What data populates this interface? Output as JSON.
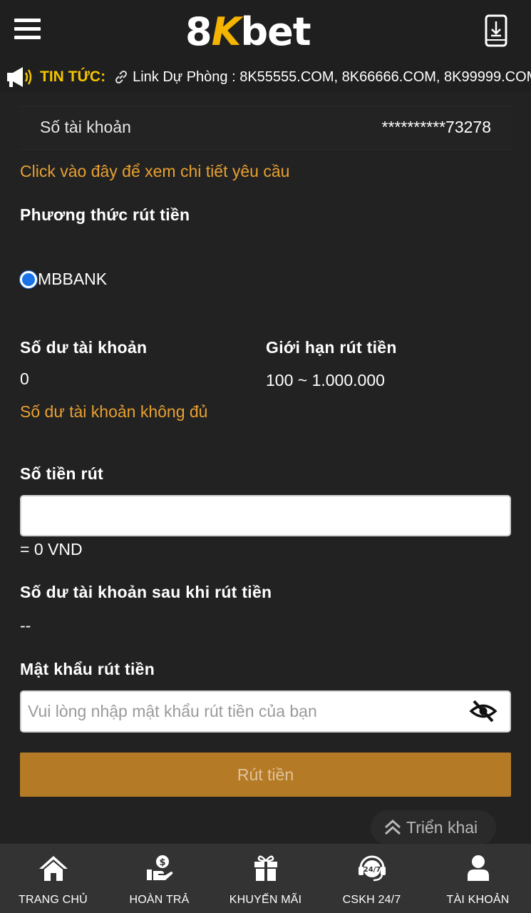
{
  "header": {
    "logo_text_a": "8",
    "logo_text_k": "K",
    "logo_text_b": "bet"
  },
  "ticker": {
    "label": "TIN TỨC:",
    "text": "Link Dự Phòng : 8K55555.COM,  8K66666.COM,  8K99999.COM"
  },
  "account": {
    "label": "Số tài khoản",
    "value": "**********73278"
  },
  "requirements_link": "Click vào đây để xem chi tiết yêu cầu",
  "method": {
    "heading": "Phương thức rút tiền",
    "option": "MBBANK",
    "selected": true
  },
  "balance": {
    "heading": "Số dư tài khoản",
    "value": "0",
    "warning": "Số dư tài khoản không đủ"
  },
  "limit": {
    "heading": "Giới hạn rút tiền",
    "value": "100 ~ 1.000.000"
  },
  "amount": {
    "heading": "Số tiền rút",
    "value": "",
    "converted": "= 0 VND"
  },
  "after_balance": {
    "heading": "Số dư tài khoản sau khi rút tiền",
    "value": "--"
  },
  "password": {
    "heading": "Mật khẩu rút tiền",
    "placeholder": "Vui lòng nhập mật khẩu rút tiền của bạn"
  },
  "submit_label": "Rút tiền",
  "expand_label": "Triển khai",
  "bottom_nav": [
    {
      "label": "TRANG CHỦ",
      "icon": "home-icon"
    },
    {
      "label": "HOÀN TRẢ",
      "icon": "cashback-icon"
    },
    {
      "label": "KHUYẾN MÃI",
      "icon": "gift-icon"
    },
    {
      "label": "CSKH 24/7",
      "icon": "support-24-7-icon"
    },
    {
      "label": "TÀI KHOẢN",
      "icon": "user-icon"
    }
  ],
  "colors": {
    "background": "#222222",
    "accent_orange": "#e8a030",
    "button": "#b57a25",
    "ticker_label": "#f5c400",
    "radio": "#1a73e8"
  }
}
